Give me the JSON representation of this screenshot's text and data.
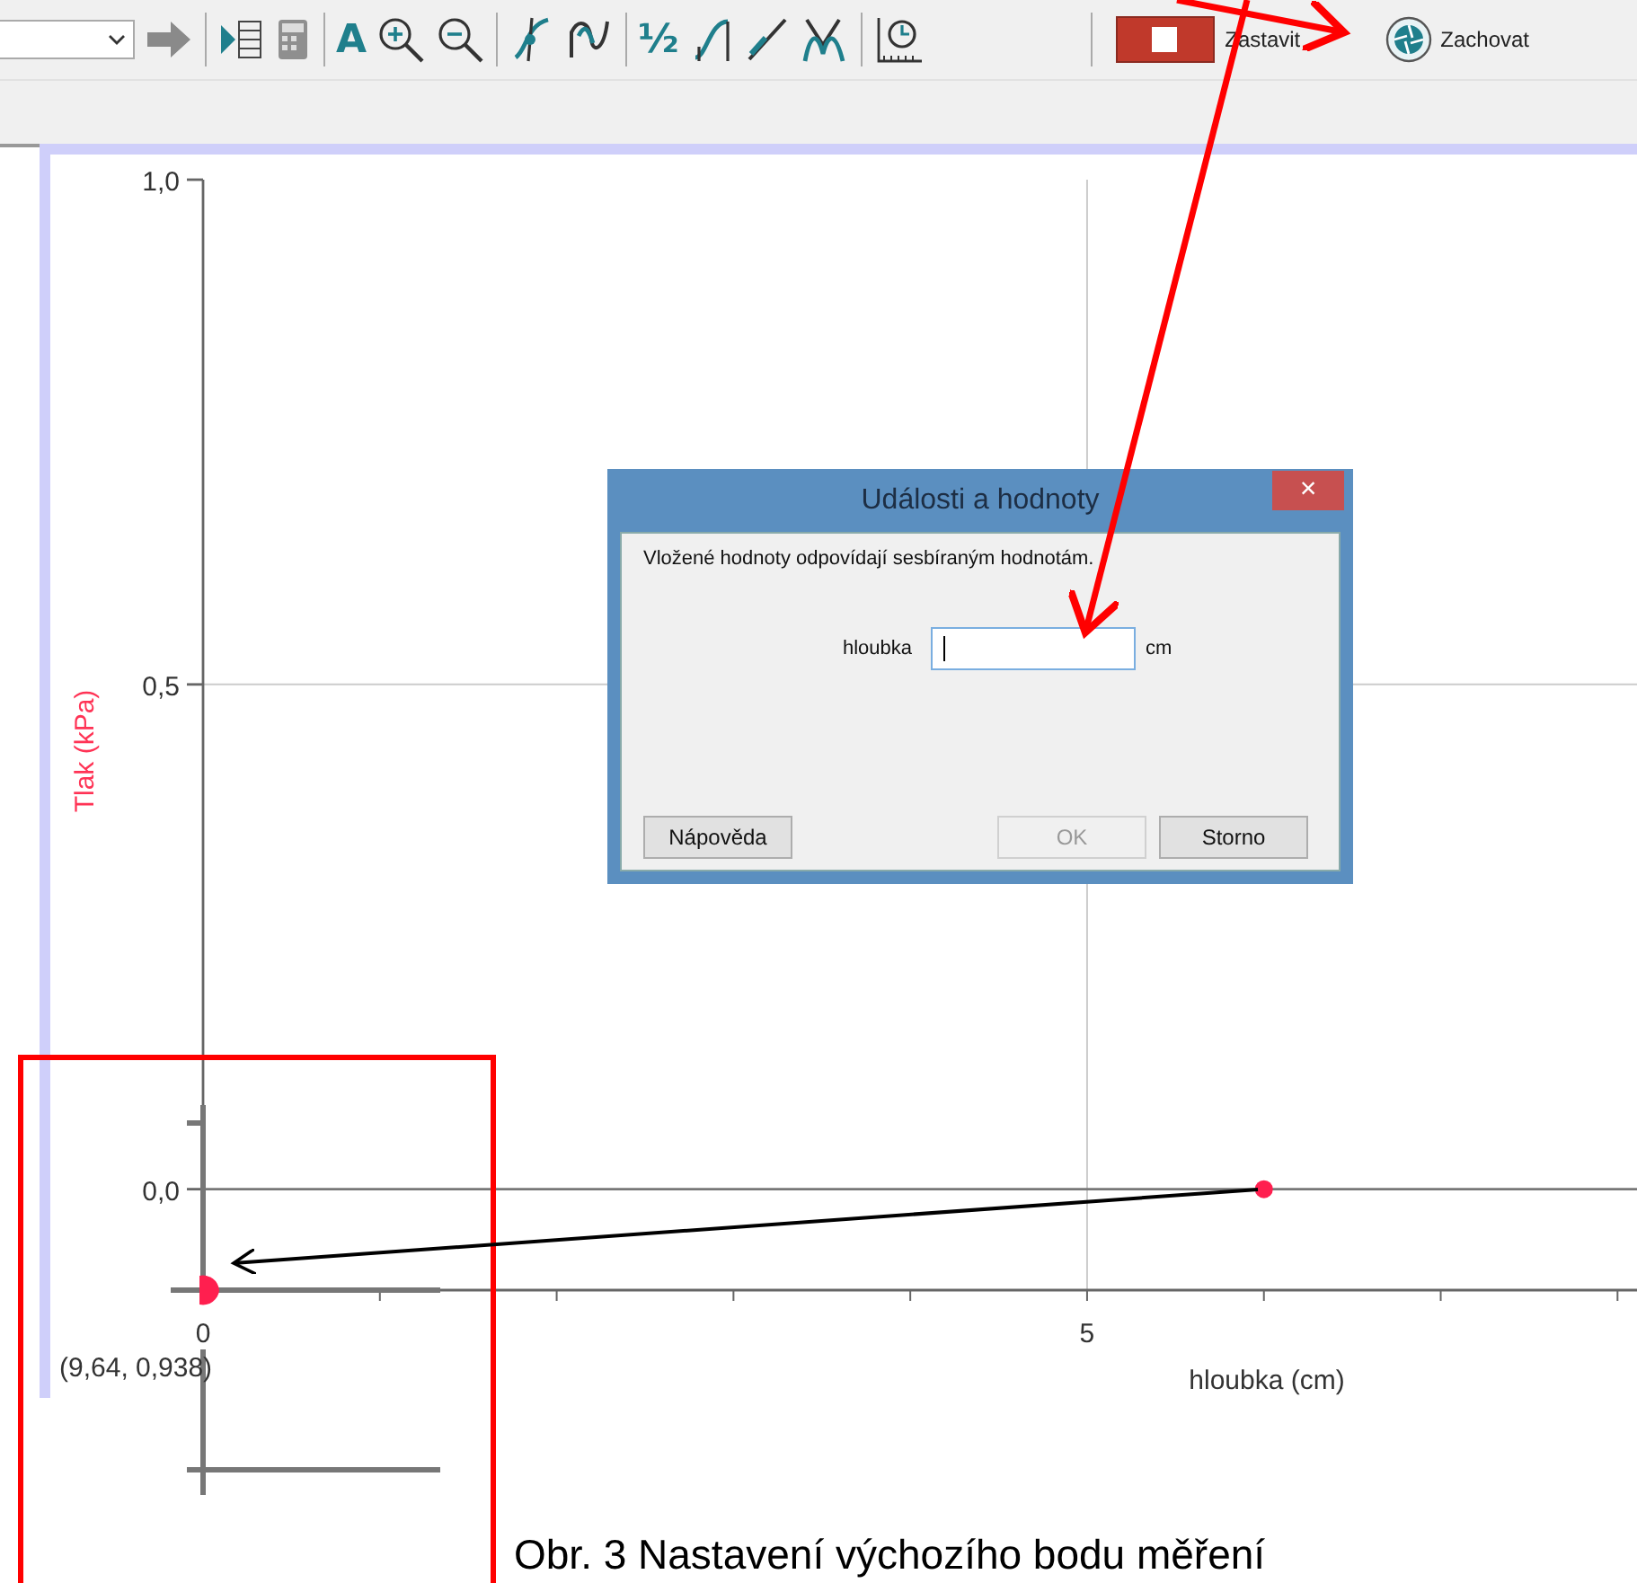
{
  "toolbar": {
    "items": [
      {
        "kind": "dropdown"
      },
      {
        "kind": "arrow"
      },
      {
        "kind": "separator"
      },
      {
        "kind": "table"
      },
      {
        "kind": "calculator"
      },
      {
        "kind": "separator"
      },
      {
        "kind": "text",
        "label": "A"
      },
      {
        "kind": "zoom-in"
      },
      {
        "kind": "zoom-out"
      },
      {
        "kind": "separator"
      },
      {
        "kind": "tangent"
      },
      {
        "kind": "curve"
      },
      {
        "kind": "separator"
      },
      {
        "kind": "text",
        "label": "½"
      },
      {
        "kind": "integral"
      },
      {
        "kind": "line"
      },
      {
        "kind": "peaks"
      },
      {
        "kind": "separator"
      },
      {
        "kind": "clock"
      }
    ],
    "buttons": [
      {
        "kind": "stop",
        "label": "Zastavit"
      },
      {
        "kind": "keep",
        "label": "Zachovat"
      }
    ]
  },
  "graph": {
    "chart_data": {
      "type": "scatter",
      "xlabel": "hloubka (cm)",
      "ylabel": "Tlak (kPa)",
      "xlim": [
        0,
        8.1
      ],
      "ylim": [
        -0.1,
        1.0
      ],
      "xticks": [
        {
          "value": 0,
          "label": "0"
        },
        {
          "value": 5,
          "label": "5"
        }
      ],
      "yticks": [
        {
          "value": 0,
          "label": "0,0"
        },
        {
          "value": 0.5,
          "label": "0,5"
        },
        {
          "value": 1,
          "label": "1,0"
        }
      ],
      "x": [
        6
      ],
      "series": [
        {
          "color": "#ff1f4f",
          "values": [
            0
          ]
        }
      ]
    },
    "inset": {
      "coordinates": "(9,64, 0,938)"
    }
  },
  "dialog": {
    "title": "Události a hodnoty",
    "close": "×",
    "message": "Vložené hodnoty odpovídají sesbíraným hodnotám.",
    "field_label": "hloubka",
    "unit": "cm",
    "buttons": [
      {
        "label": "Nápověda",
        "disabled": false
      },
      {
        "label": "OK",
        "disabled": true
      },
      {
        "label": "Storno",
        "disabled": false
      }
    ]
  },
  "caption": "Obr. 3 Nastavení výchozího bodu měření"
}
